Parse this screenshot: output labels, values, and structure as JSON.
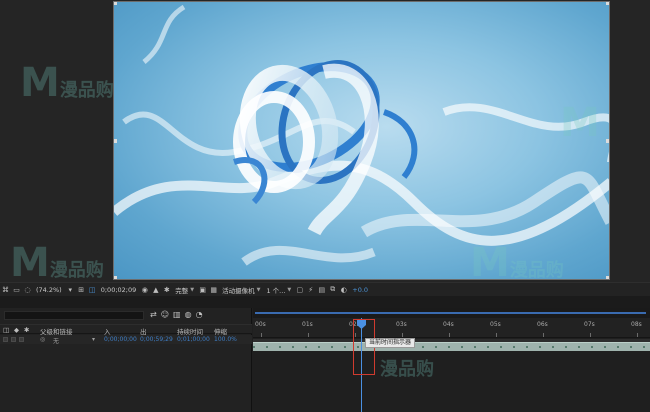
{
  "toolbar": {
    "zoom": "(74.2%)",
    "timecode": "0;00;02;09",
    "resolution": "完整",
    "camera": "活动摄像机",
    "views": "1 个...",
    "exposure": "+0.0"
  },
  "timeline": {
    "columns": {
      "parent": "父级和链接",
      "in": "入",
      "out": "出",
      "duration": "持续时间",
      "stretch": "伸缩"
    },
    "layer": {
      "parent_value": "无",
      "in_value": "0;00;00;00",
      "out_value": "0;00;59;29",
      "duration_value": "0;01;00;00",
      "stretch_value": "100.0%"
    },
    "ruler_ticks": [
      "00s",
      "01s",
      "02s",
      "03s",
      "04s",
      "05s",
      "06s",
      "07s",
      "08s"
    ],
    "tooltip": "当前时间指示器"
  },
  "watermark": {
    "letter": "M",
    "text": "漫品购",
    "sub": "SHOP"
  },
  "colors": {
    "playhead": "#4a90e2",
    "highlight_box": "#d03b2f",
    "clip": "#9fb3ad",
    "accent_blue": "#4b93d6"
  }
}
